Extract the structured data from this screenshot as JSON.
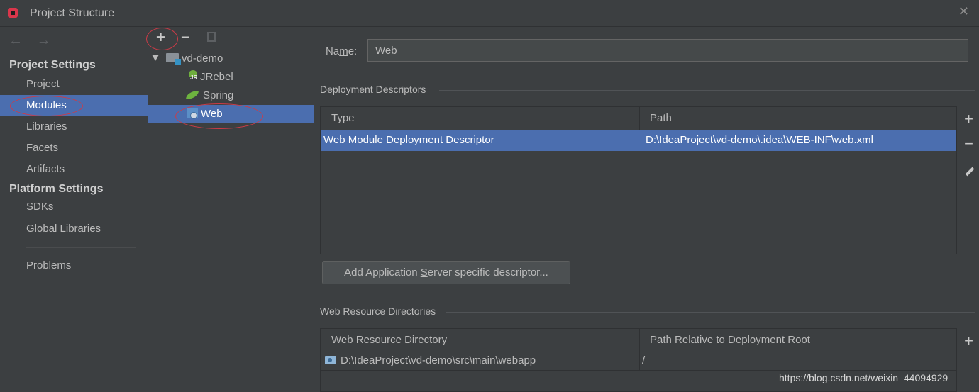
{
  "window": {
    "title": "Project Structure",
    "close_glyph": "✕"
  },
  "nav": {
    "back": "←",
    "forward": "→"
  },
  "sidebar": {
    "project_settings_header": "Project Settings",
    "platform_settings_header": "Platform Settings",
    "items": [
      {
        "label": "Project"
      },
      {
        "label": "Modules",
        "selected": true
      },
      {
        "label": "Libraries"
      },
      {
        "label": "Facets"
      },
      {
        "label": "Artifacts"
      },
      {
        "label": "SDKs"
      },
      {
        "label": "Global Libraries"
      },
      {
        "label": "Problems"
      }
    ]
  },
  "tree_toolbar": {
    "add": "+",
    "remove": "−"
  },
  "tree": {
    "root": "vd-demo",
    "children": [
      "JRebel",
      "Spring",
      "Web"
    ],
    "selected": "Web"
  },
  "detail": {
    "name_label_prefix": "Na",
    "name_label_mnemonic": "m",
    "name_label_suffix": "e:",
    "name_value": "Web",
    "deployment_descriptors": {
      "title": "Deployment Descriptors",
      "columns": [
        "Type",
        "Path"
      ],
      "rows": [
        {
          "type": "Web Module Deployment Descriptor",
          "path": "D:\\IdeaProject\\vd-demo\\.idea\\WEB-INF\\web.xml"
        }
      ]
    },
    "add_descriptor_button": {
      "prefix": "Add Application ",
      "mnemonic": "S",
      "suffix": "erver specific descriptor..."
    },
    "web_resource_directories": {
      "title": "Web Resource Directories",
      "columns": [
        "Web Resource Directory",
        "Path Relative to Deployment Root"
      ],
      "rows": [
        {
          "directory": "D:\\IdeaProject\\vd-demo\\src\\main\\webapp",
          "relative": "/"
        }
      ]
    },
    "side_tools": {
      "add": "+",
      "remove": "−"
    }
  },
  "watermark": "https://blog.csdn.net/weixin_44094929",
  "colors": {
    "background": "#3c3f41",
    "selection": "#4b6eaf",
    "annotation": "#cc3b47"
  },
  "icons": [
    "app-icon",
    "back-arrow-icon",
    "forward-arrow-icon",
    "add-icon",
    "remove-icon",
    "copy-icon",
    "folder-module-icon",
    "jrebel-icon",
    "spring-icon",
    "web-icon",
    "edit-pencil-icon",
    "web-directory-icon",
    "close-icon"
  ]
}
